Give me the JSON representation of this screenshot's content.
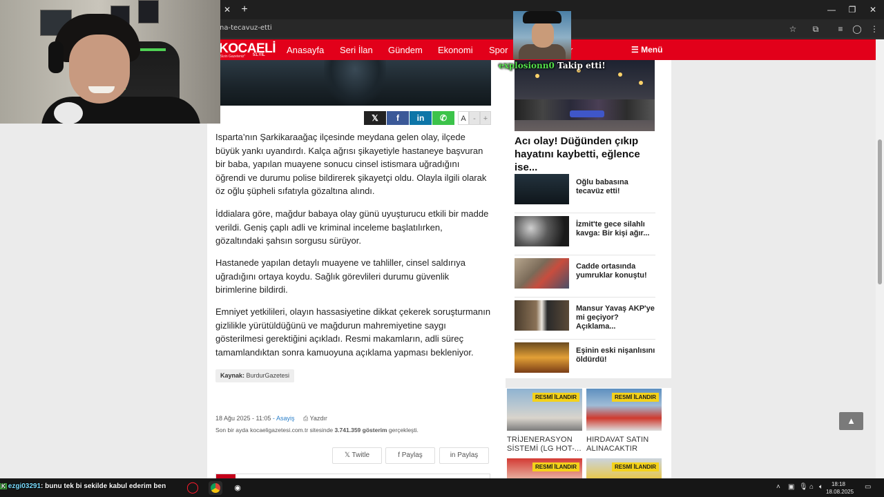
{
  "browser": {
    "url": "na-tecavuz-etti",
    "tab_close_glyph": "✕",
    "new_tab_glyph": "+",
    "window_controls": [
      "—",
      "❐",
      "✕"
    ],
    "toolbar_icons": [
      "star-icon",
      "extensions-icon",
      "media-icon",
      "profile-icon",
      "kebab-menu-icon"
    ]
  },
  "site": {
    "logo": "KOCAELİ",
    "logo_sub": "\"Sizin Gazeteniz\"",
    "logo_year": "51.YIL",
    "nav": [
      "Anasayfa",
      "Seri İlan",
      "Gündem",
      "Ekonomi",
      "Spor",
      "r"
    ],
    "menu_label": "☰ Menü",
    "brand_color": "#e2001a"
  },
  "share_bar": {
    "buttons": [
      "𝕏",
      "f",
      "in",
      "✆"
    ],
    "font_label": "A",
    "font_minus": "-",
    "font_plus": "+"
  },
  "article": {
    "paragraphs": [
      "Isparta’nın Şarkikaraağaç ilçesinde meydana gelen olay, ilçede büyük yankı uyandırdı. Kalça ağrısı şikayetiyle hastaneye başvuran bir baba, yapılan muayene sonucu cinsel istismara uğradığını öğrendi ve durumu polise bildirerek şikayetçi oldu. Olayla ilgili olarak öz oğlu şüpheli sıfatıyla gözaltına alındı.",
      "İddialara göre, mağdur babaya olay günü uyuşturucu etkili bir madde verildi. Geniş çaplı adli ve kriminal inceleme başlatılırken, gözaltındaki şahsın sorgusu sürüyor.",
      "Hastanede yapılan detaylı muayene ve tahliller, cinsel saldırıya uğradığını ortaya koydu. Sağlık görevlileri durumu güvenlik birimlerine bildirdi.",
      "Emniyet yetkilileri, olayın hassasiyetine dikkat çekerek soruşturmanın gizlilikle yürütüldüğünü ve mağdurun mahremiyetine saygı gösterilmesi gerektiğini açıkladı. Resmi makamların, adli süreç tamamlandıktan sonra kamuoyuna açıklama yapması bekleniyor."
    ],
    "source_label": "Kaynak:",
    "source_value": "BurdurGazetesi",
    "date": "18 Ağu 2025 - 11:05",
    "separator": "-",
    "category": "Asayiş",
    "print_label": "⎙ Yazdır",
    "stats_prefix": "Son bir ayda kocaeligazetesi.com.tr sitesinde",
    "stats_count": "3.741.359 gösterim",
    "stats_suffix": "gerçekleşti.",
    "share_twitter": "𝕏  Twitle",
    "share_facebook": "f  Paylaş",
    "share_linkedin": "in  Paylaş"
  },
  "sidebar": {
    "headline": "Acı olay! Düğünden çıkıp hayatını kaybetti, eğlence ise...",
    "news": [
      {
        "title": "Oğlu babasına tecavüz etti!"
      },
      {
        "title": "İzmit'te gece silahlı kavga: Bir kişi ağır..."
      },
      {
        "title": "Cadde ortasında yumruklar konuştu!"
      },
      {
        "title": "Mansur Yavaş AKP'ye mi geçiyor? Açıklama..."
      },
      {
        "title": "Eşinin eski nişanlısını öldürdü!"
      }
    ],
    "ads": [
      {
        "badge": "RESMİ İLANDIR",
        "title": "TRİJENERASYON SİSTEMİ (LG HOT-..."
      },
      {
        "badge": "RESMİ İLANDIR",
        "title": "HIRDAVAT SATIN ALINACAKTIR"
      },
      {
        "badge": "RESMİ İLANDIR",
        "title": ""
      },
      {
        "badge": "RESMİ İLANDIR",
        "title": ""
      }
    ]
  },
  "to_top_glyph": "▲",
  "stream_overlay": {
    "follow_user": "explosionn0",
    "follow_text": "Takip etti!",
    "chat_user": "ezgi03291",
    "chat_message": ": bunu tek bi sekilde kabul ederim ben"
  },
  "taskbar": {
    "time": "18:18",
    "date": "18.08.2025",
    "apps": [
      "opera-icon",
      "chrome-icon",
      "obs-icon"
    ]
  }
}
